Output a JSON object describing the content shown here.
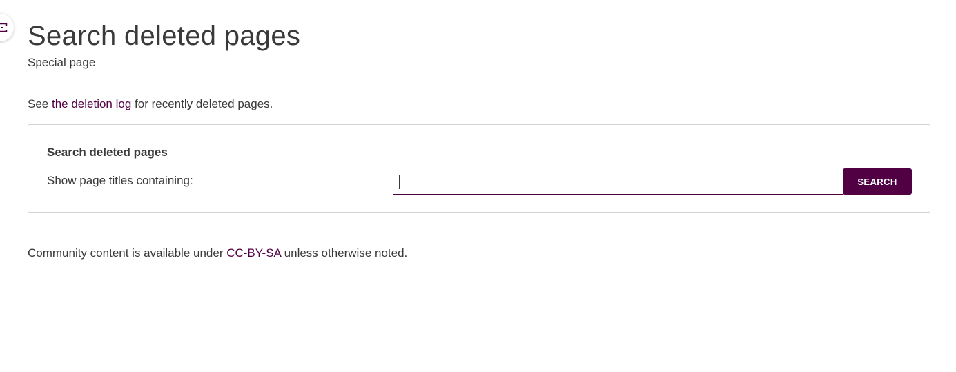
{
  "colors": {
    "accent": "#520044",
    "text": "#3a3a3a",
    "border": "#d2d2d2"
  },
  "sidebar_toggle": {
    "icon": "expand-icon"
  },
  "header": {
    "title": "Search deleted pages",
    "subtitle": "Special page"
  },
  "intro": {
    "prefix": "See ",
    "link_text": "the deletion log",
    "suffix": " for recently deleted pages."
  },
  "search_form": {
    "legend": "Search deleted pages",
    "label": "Show page titles containing:",
    "input_value": "",
    "input_placeholder": "",
    "button_label": "SEARCH"
  },
  "footer": {
    "prefix": "Community content is available under ",
    "license_link": "CC-BY-SA",
    "suffix": " unless otherwise noted."
  }
}
